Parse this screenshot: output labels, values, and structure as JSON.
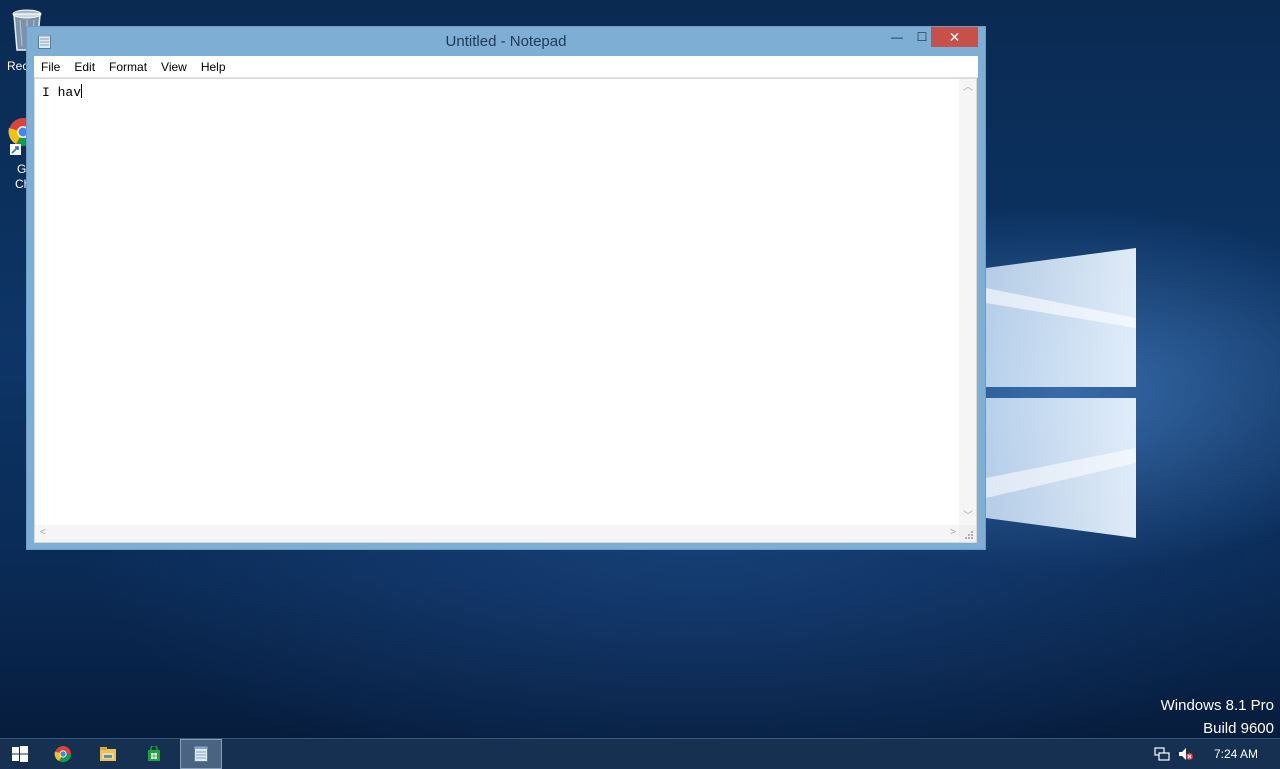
{
  "desktop": {
    "icons": [
      {
        "label": "Recycle Bin"
      },
      {
        "label_line1": "G",
        "label_line2": "Ch"
      }
    ],
    "recycle_visible_label": "Rec",
    "watermark": {
      "line1": "Windows 8.1 Pro",
      "line2": "Build 9600"
    }
  },
  "notepad": {
    "title": "Untitled - Notepad",
    "menu": [
      "File",
      "Edit",
      "Format",
      "View",
      "Help"
    ],
    "content": "I hav",
    "controls": {
      "minimize": "—",
      "maximize": "☐",
      "close": "✕"
    }
  },
  "taskbar": {
    "apps": [
      "start-icon",
      "chrome-icon",
      "file-explorer-icon",
      "store-icon",
      "notepad-icon"
    ],
    "clock": "7:24 AM",
    "colors": {
      "chrome_red": "#db4437",
      "chrome_yellow": "#f4c20d",
      "chrome_green": "#0f9d58",
      "chrome_blue": "#4285f4",
      "store_green": "#1da43c"
    }
  }
}
